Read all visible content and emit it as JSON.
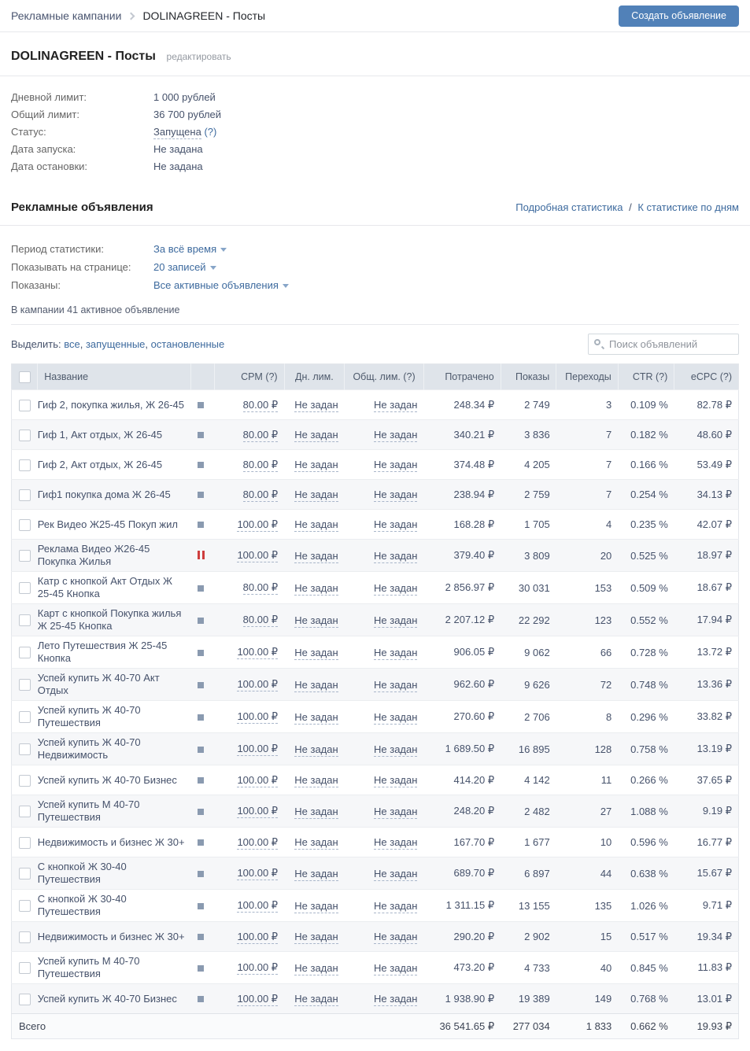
{
  "breadcrumb": {
    "root": "Рекламные кампании",
    "current": "DOLINAGREEN - Посты"
  },
  "create_button_label": "Создать объявление",
  "campaign": {
    "title": "DOLINAGREEN - Посты",
    "edit_link": "редактировать",
    "details": [
      {
        "label": "Дневной лимит:",
        "value": "1 000 рублей",
        "style": "plain"
      },
      {
        "label": "Общий лимит:",
        "value": "36 700 рублей",
        "style": "plain"
      },
      {
        "label": "Статус:",
        "value": "Запущена",
        "suffix": "(?)",
        "style": "status"
      },
      {
        "label": "Дата запуска:",
        "value": "Не задана",
        "style": "plain"
      },
      {
        "label": "Дата остановки:",
        "value": "Не задана",
        "style": "plain"
      }
    ]
  },
  "ads_section": {
    "title": "Рекламные объявления",
    "link_detailed": "Подробная статистика",
    "link_separator": "/",
    "link_by_days": "К статистике по дням",
    "filters": [
      {
        "label": "Период статистики:",
        "value": "За всё время"
      },
      {
        "label": "Показывать на странице:",
        "value": "20 записей"
      },
      {
        "label": "Показаны:",
        "value": "Все активные объявления"
      }
    ],
    "count_text": "В кампании 41 активное объявление"
  },
  "select_bar": {
    "label": "Выделить:",
    "option_all": "все",
    "option_running": "запущенные",
    "option_stopped": "остановленные",
    "search_placeholder": "Поиск объявлений"
  },
  "table": {
    "columns": {
      "name": "Название",
      "cpm": "CPM (?)",
      "daily_limit": "Дн. лим.",
      "total_limit": "Общ. лим. (?)",
      "spent": "Потрачено",
      "impressions": "Показы",
      "clicks": "Переходы",
      "ctr": "CTR (?)",
      "ecpc": "eCPC (?)"
    },
    "rows": [
      {
        "name": "Гиф 2, покупка жилья, Ж 26-45",
        "status": "stopped",
        "cpm": "80.00 ₽",
        "daily_limit": "Не задан",
        "total_limit": "Не задан",
        "spent": "248.34 ₽",
        "impressions": "2 749",
        "clicks": "3",
        "ctr": "0.109 %",
        "ecpc": "82.78 ₽"
      },
      {
        "name": "Гиф 1, Акт отдых, Ж 26-45",
        "status": "stopped",
        "cpm": "80.00 ₽",
        "daily_limit": "Не задан",
        "total_limit": "Не задан",
        "spent": "340.21 ₽",
        "impressions": "3 836",
        "clicks": "7",
        "ctr": "0.182 %",
        "ecpc": "48.60 ₽"
      },
      {
        "name": "Гиф 2, Акт отдых, Ж 26-45",
        "status": "stopped",
        "cpm": "80.00 ₽",
        "daily_limit": "Не задан",
        "total_limit": "Не задан",
        "spent": "374.48 ₽",
        "impressions": "4 205",
        "clicks": "7",
        "ctr": "0.166 %",
        "ecpc": "53.49 ₽"
      },
      {
        "name": "Гиф1 покупка дома Ж 26-45",
        "status": "stopped",
        "cpm": "80.00 ₽",
        "daily_limit": "Не задан",
        "total_limit": "Не задан",
        "spent": "238.94 ₽",
        "impressions": "2 759",
        "clicks": "7",
        "ctr": "0.254 %",
        "ecpc": "34.13 ₽"
      },
      {
        "name": "Рек Видео Ж25-45 Покуп жил",
        "status": "stopped",
        "cpm": "100.00 ₽",
        "daily_limit": "Не задан",
        "total_limit": "Не задан",
        "spent": "168.28 ₽",
        "impressions": "1 705",
        "clicks": "4",
        "ctr": "0.235 %",
        "ecpc": "42.07 ₽"
      },
      {
        "name": "Реклама Видео Ж26-45 Покупка Жилья",
        "status": "paused",
        "cpm": "100.00 ₽",
        "daily_limit": "Не задан",
        "total_limit": "Не задан",
        "spent": "379.40 ₽",
        "impressions": "3 809",
        "clicks": "20",
        "ctr": "0.525 %",
        "ecpc": "18.97 ₽"
      },
      {
        "name": "Катр с кнопкой Акт Отдых Ж 25-45 Кнопка",
        "status": "stopped",
        "cpm": "80.00 ₽",
        "daily_limit": "Не задан",
        "total_limit": "Не задан",
        "spent": "2 856.97 ₽",
        "impressions": "30 031",
        "clicks": "153",
        "ctr": "0.509 %",
        "ecpc": "18.67 ₽"
      },
      {
        "name": "Карт с кнопкой Покупка жилья Ж 25-45 Кнопка",
        "status": "stopped",
        "cpm": "80.00 ₽",
        "daily_limit": "Не задан",
        "total_limit": "Не задан",
        "spent": "2 207.12 ₽",
        "impressions": "22 292",
        "clicks": "123",
        "ctr": "0.552 %",
        "ecpc": "17.94 ₽"
      },
      {
        "name": "Лето Путешествия Ж 25-45 Кнопка",
        "status": "stopped",
        "cpm": "100.00 ₽",
        "daily_limit": "Не задан",
        "total_limit": "Не задан",
        "spent": "906.05 ₽",
        "impressions": "9 062",
        "clicks": "66",
        "ctr": "0.728 %",
        "ecpc": "13.72 ₽"
      },
      {
        "name": "Успей купить Ж 40-70 Акт Отдых",
        "status": "stopped",
        "cpm": "100.00 ₽",
        "daily_limit": "Не задан",
        "total_limit": "Не задан",
        "spent": "962.60 ₽",
        "impressions": "9 626",
        "clicks": "72",
        "ctr": "0.748 %",
        "ecpc": "13.36 ₽"
      },
      {
        "name": "Успей купить Ж 40-70 Путешествия",
        "status": "stopped",
        "cpm": "100.00 ₽",
        "daily_limit": "Не задан",
        "total_limit": "Не задан",
        "spent": "270.60 ₽",
        "impressions": "2 706",
        "clicks": "8",
        "ctr": "0.296 %",
        "ecpc": "33.82 ₽"
      },
      {
        "name": "Успей купить Ж 40-70 Недвижимость",
        "status": "stopped",
        "cpm": "100.00 ₽",
        "daily_limit": "Не задан",
        "total_limit": "Не задан",
        "spent": "1 689.50 ₽",
        "impressions": "16 895",
        "clicks": "128",
        "ctr": "0.758 %",
        "ecpc": "13.19 ₽"
      },
      {
        "name": "Успей купить Ж 40-70 Бизнес",
        "status": "stopped",
        "cpm": "100.00 ₽",
        "daily_limit": "Не задан",
        "total_limit": "Не задан",
        "spent": "414.20 ₽",
        "impressions": "4 142",
        "clicks": "11",
        "ctr": "0.266 %",
        "ecpc": "37.65 ₽"
      },
      {
        "name": "Успей купить М 40-70 Путешествия",
        "status": "stopped",
        "cpm": "100.00 ₽",
        "daily_limit": "Не задан",
        "total_limit": "Не задан",
        "spent": "248.20 ₽",
        "impressions": "2 482",
        "clicks": "27",
        "ctr": "1.088 %",
        "ecpc": "9.19 ₽"
      },
      {
        "name": "Недвижимость и бизнес Ж 30+",
        "status": "stopped",
        "cpm": "100.00 ₽",
        "daily_limit": "Не задан",
        "total_limit": "Не задан",
        "spent": "167.70 ₽",
        "impressions": "1 677",
        "clicks": "10",
        "ctr": "0.596 %",
        "ecpc": "16.77 ₽"
      },
      {
        "name": "С кнопкой Ж 30-40 Путешествия",
        "status": "stopped",
        "cpm": "100.00 ₽",
        "daily_limit": "Не задан",
        "total_limit": "Не задан",
        "spent": "689.70 ₽",
        "impressions": "6 897",
        "clicks": "44",
        "ctr": "0.638 %",
        "ecpc": "15.67 ₽"
      },
      {
        "name": "С кнопкой Ж 30-40 Путешествия",
        "status": "stopped",
        "cpm": "100.00 ₽",
        "daily_limit": "Не задан",
        "total_limit": "Не задан",
        "spent": "1 311.15 ₽",
        "impressions": "13 155",
        "clicks": "135",
        "ctr": "1.026 %",
        "ecpc": "9.71 ₽"
      },
      {
        "name": "Недвижимость и бизнес Ж 30+",
        "status": "stopped",
        "cpm": "100.00 ₽",
        "daily_limit": "Не задан",
        "total_limit": "Не задан",
        "spent": "290.20 ₽",
        "impressions": "2 902",
        "clicks": "15",
        "ctr": "0.517 %",
        "ecpc": "19.34 ₽"
      },
      {
        "name": "Успей купить М 40-70 Путешествия",
        "status": "stopped",
        "cpm": "100.00 ₽",
        "daily_limit": "Не задан",
        "total_limit": "Не задан",
        "spent": "473.20 ₽",
        "impressions": "4 733",
        "clicks": "40",
        "ctr": "0.845 %",
        "ecpc": "11.83 ₽"
      },
      {
        "name": "Успей купить Ж 40-70 Бизнес",
        "status": "stopped",
        "cpm": "100.00 ₽",
        "daily_limit": "Не задан",
        "total_limit": "Не задан",
        "spent": "1 938.90 ₽",
        "impressions": "19 389",
        "clicks": "149",
        "ctr": "0.768 %",
        "ecpc": "13.01 ₽"
      }
    ],
    "footer": {
      "label": "Всего",
      "spent": "36 541.65 ₽",
      "impressions": "277 034",
      "clicks": "1 833",
      "ctr": "0.662 %",
      "ecpc": "19.93 ₽"
    }
  },
  "colors": {
    "accent_blue": "#5181b8",
    "link_blue": "#3d6a9e",
    "paused_red": "#ce3e3e",
    "stopped_gray": "#8a9ab0",
    "table_header_bg": "#dfe4ea"
  }
}
